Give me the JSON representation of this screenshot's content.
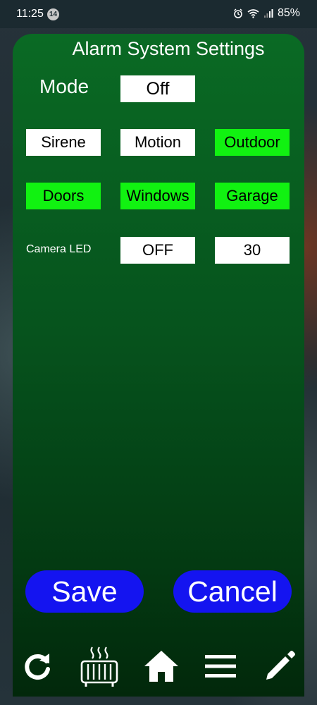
{
  "status_bar": {
    "time": "11:25",
    "notification_count": "14",
    "battery": "85%",
    "icons": [
      "alarm-clock-icon",
      "wifi-icon",
      "signal-icon"
    ]
  },
  "settings": {
    "title": "Alarm System Settings",
    "mode_label": "Mode",
    "mode_value": "Off",
    "zones": [
      {
        "label": "Sirene",
        "active": false
      },
      {
        "label": "Motion",
        "active": false
      },
      {
        "label": "Outdoor",
        "active": true
      },
      {
        "label": "Doors",
        "active": true
      },
      {
        "label": "Windows",
        "active": true
      },
      {
        "label": "Garage",
        "active": true
      }
    ],
    "camera_led_label": "Camera LED",
    "camera_led_value": "OFF",
    "camera_led_number": "30"
  },
  "actions": {
    "save_label": "Save",
    "cancel_label": "Cancel"
  },
  "bottom_nav": [
    "refresh-icon",
    "radiator-icon",
    "home-icon",
    "menu-icon",
    "pencil-icon"
  ],
  "colors": {
    "panel_green": "#0a6a24",
    "active_green": "#11f211",
    "button_blue": "#1414f0",
    "inactive_box": "#ffffff"
  }
}
